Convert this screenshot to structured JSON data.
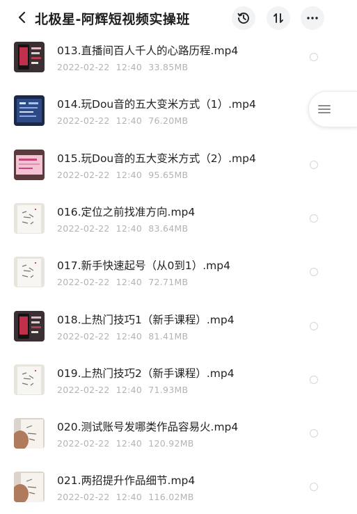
{
  "header": {
    "title": "北极星-阿辉短视频实操班",
    "icons": [
      "back-arrow-icon",
      "history-icon",
      "sort-icon",
      "more-icon"
    ]
  },
  "files": [
    {
      "name": "013.直播间百人千人的心路历程.mp4",
      "date": "2022-02-22",
      "time": "12:40",
      "size": "33.85MB",
      "thumb": "dark-phone"
    },
    {
      "name": "014.玩Dou音的五大变米方式（1）.mp4",
      "date": "2022-02-22",
      "time": "12:40",
      "size": "76.20MB",
      "thumb": "blue-screen"
    },
    {
      "name": "015.玩Dou音的五大变米方式（2）.mp4",
      "date": "2022-02-22",
      "time": "12:40",
      "size": "95.65MB",
      "thumb": "pink-screen"
    },
    {
      "name": "016.定位之前找准方向.mp4",
      "date": "2022-02-22",
      "time": "12:40",
      "size": "83.64MB",
      "thumb": "notepad"
    },
    {
      "name": "017.新手快速起号（从0到1）.mp4",
      "date": "2022-02-22",
      "time": "12:40",
      "size": "72.71MB",
      "thumb": "notepad"
    },
    {
      "name": "018.上热门技巧1（新手课程）.mp4",
      "date": "2022-02-22",
      "time": "12:40",
      "size": "81.41MB",
      "thumb": "dark-phone"
    },
    {
      "name": "019.上热门技巧2（新手课程）.mp4",
      "date": "2022-02-22",
      "time": "12:40",
      "size": "71.93MB",
      "thumb": "notepad"
    },
    {
      "name": "020.测试账号发哪类作品容易火.mp4",
      "date": "2022-02-22",
      "time": "12:40",
      "size": "120.92MB",
      "thumb": "hand-note"
    },
    {
      "name": "021.两招提升作品细节.mp4",
      "date": "2022-02-22",
      "time": "12:40",
      "size": "116.02MB",
      "thumb": "hand-note"
    }
  ]
}
